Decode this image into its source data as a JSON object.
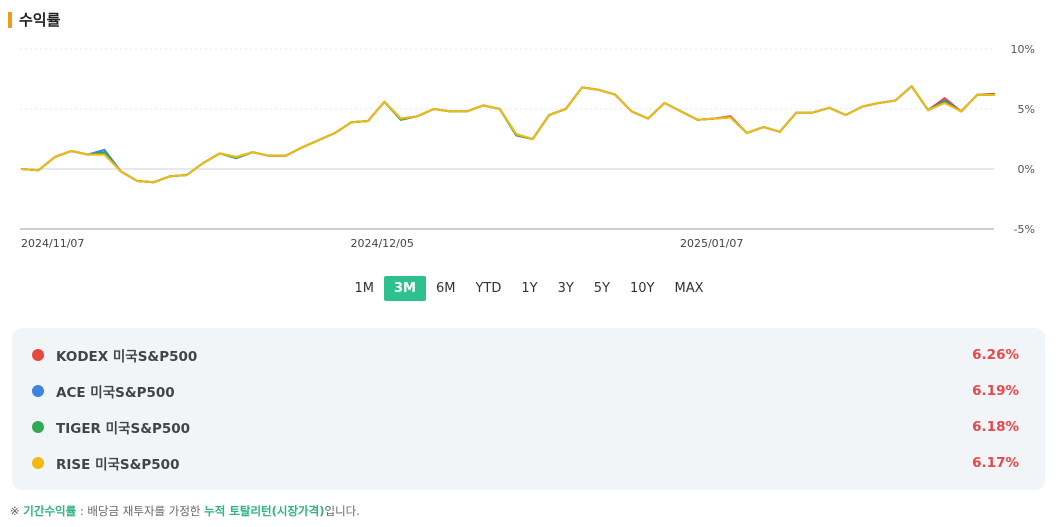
{
  "title": "수익률",
  "accent_color": "#f29a1f",
  "chart_data": {
    "type": "line",
    "x_ticks": [
      "2024/11/07",
      "2024/12/05",
      "2025/01/07"
    ],
    "x_tick_index": [
      0,
      20,
      40
    ],
    "y_ticks": [
      "10%",
      "5%",
      "0%",
      "-5%"
    ],
    "y_tick_values": [
      10,
      5,
      0,
      -5
    ],
    "ylim": [
      -5,
      10
    ],
    "grid": true,
    "series": [
      {
        "name": "KODEX 미국S&P500",
        "color": "#e8473e",
        "values": [
          0.0,
          -0.1,
          1.0,
          1.5,
          1.2,
          1.3,
          -0.2,
          -1.0,
          -1.1,
          -0.6,
          -0.5,
          0.5,
          1.3,
          1.0,
          1.4,
          1.1,
          1.1,
          1.8,
          2.4,
          3.0,
          3.9,
          4.0,
          5.6,
          4.2,
          4.4,
          5.0,
          4.8,
          4.8,
          5.3,
          5.0,
          2.9,
          2.5,
          4.5,
          5.0,
          6.8,
          6.6,
          6.2,
          4.8,
          4.2,
          5.5,
          4.8,
          4.1,
          4.2,
          4.4,
          3.0,
          3.5,
          3.1,
          4.7,
          4.7,
          5.1,
          4.5,
          5.2,
          5.5,
          5.7,
          6.9,
          4.9,
          5.9,
          4.8,
          6.2,
          6.26
        ]
      },
      {
        "name": "ACE 미국S&P500",
        "color": "#3f83e0",
        "values": [
          0.0,
          -0.1,
          1.0,
          1.5,
          1.2,
          1.6,
          -0.2,
          -1.0,
          -1.1,
          -0.6,
          -0.5,
          0.5,
          1.3,
          0.9,
          1.4,
          1.1,
          1.1,
          1.8,
          2.4,
          3.0,
          3.9,
          4.0,
          5.6,
          4.1,
          4.4,
          5.0,
          4.8,
          4.8,
          5.3,
          5.0,
          2.8,
          2.5,
          4.5,
          5.0,
          6.8,
          6.6,
          6.2,
          4.8,
          4.2,
          5.5,
          4.8,
          4.1,
          4.2,
          4.3,
          3.0,
          3.5,
          3.1,
          4.7,
          4.7,
          5.1,
          4.5,
          5.2,
          5.5,
          5.7,
          6.9,
          4.9,
          5.7,
          4.8,
          6.2,
          6.19
        ]
      },
      {
        "name": "TIGER 미국S&P500",
        "color": "#34a853",
        "values": [
          0.0,
          -0.1,
          1.0,
          1.5,
          1.2,
          1.4,
          -0.2,
          -1.0,
          -1.1,
          -0.6,
          -0.5,
          0.5,
          1.3,
          0.9,
          1.4,
          1.1,
          1.1,
          1.8,
          2.4,
          3.0,
          3.9,
          4.0,
          5.6,
          4.1,
          4.4,
          5.0,
          4.8,
          4.8,
          5.3,
          5.0,
          2.8,
          2.5,
          4.5,
          5.0,
          6.8,
          6.6,
          6.2,
          4.8,
          4.2,
          5.5,
          4.8,
          4.1,
          4.2,
          4.3,
          3.0,
          3.5,
          3.1,
          4.7,
          4.7,
          5.1,
          4.5,
          5.2,
          5.5,
          5.7,
          6.9,
          4.9,
          5.6,
          4.8,
          6.2,
          6.18
        ]
      },
      {
        "name": "RISE 미국S&P500",
        "color": "#f2b90f",
        "values": [
          0.0,
          -0.1,
          1.0,
          1.5,
          1.2,
          1.2,
          -0.2,
          -1.0,
          -1.1,
          -0.6,
          -0.5,
          0.5,
          1.3,
          1.0,
          1.4,
          1.1,
          1.1,
          1.8,
          2.4,
          3.0,
          3.9,
          4.0,
          5.6,
          4.2,
          4.4,
          5.0,
          4.8,
          4.8,
          5.3,
          5.0,
          2.9,
          2.5,
          4.5,
          5.0,
          6.8,
          6.6,
          6.2,
          4.8,
          4.2,
          5.5,
          4.8,
          4.1,
          4.2,
          4.3,
          3.0,
          3.5,
          3.1,
          4.7,
          4.7,
          5.1,
          4.5,
          5.2,
          5.5,
          5.7,
          6.9,
          4.9,
          5.5,
          4.8,
          6.2,
          6.17
        ]
      }
    ]
  },
  "periods": [
    "1M",
    "3M",
    "6M",
    "YTD",
    "1Y",
    "3Y",
    "5Y",
    "10Y",
    "MAX"
  ],
  "active_period": "3M",
  "legend": [
    {
      "name": "KODEX 미국S&P500",
      "value": "6.26%",
      "color": "#e8473e"
    },
    {
      "name": "ACE 미국S&P500",
      "value": "6.19%",
      "color": "#3f83e0"
    },
    {
      "name": "TIGER 미국S&P500",
      "value": "6.18%",
      "color": "#34a853"
    },
    {
      "name": "RISE 미국S&P500",
      "value": "6.17%",
      "color": "#f2b90f"
    }
  ],
  "footnote": {
    "prefix": "※ ",
    "term": "기간수익률",
    "middle": " : 배당금 재투자를 가정한 ",
    "highlight": "누적 토탈리턴(시장가격)",
    "suffix": "입니다."
  }
}
